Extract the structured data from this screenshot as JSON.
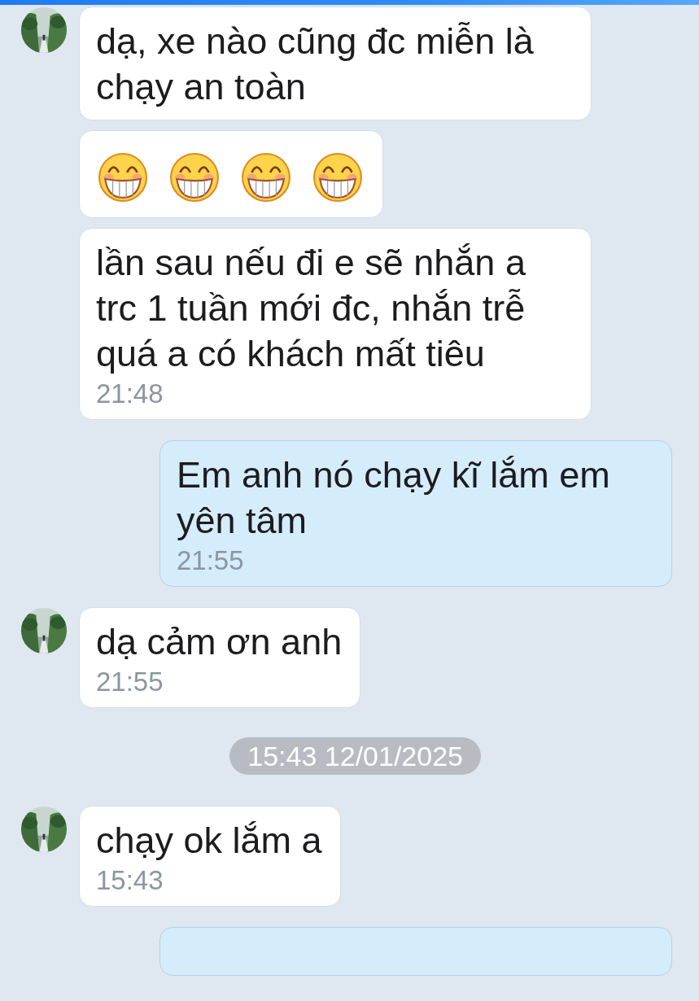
{
  "messages": [
    {
      "from_me": false,
      "avatar": true,
      "kind": "text",
      "text": "dạ, xe nào cũng đc miễn là chạy an toàn"
    },
    {
      "from_me": false,
      "avatar": false,
      "kind": "stickers",
      "stickers": [
        {
          "kind": "grin"
        },
        {
          "kind": "grin"
        },
        {
          "kind": "grin"
        },
        {
          "kind": "grin"
        }
      ]
    },
    {
      "from_me": false,
      "avatar": false,
      "kind": "text",
      "text": "lần sau nếu đi e sẽ nhắn a trc 1 tuần mới đc, nhắn trễ quá a có khách mất tiêu",
      "time": "21:48"
    },
    {
      "from_me": true,
      "kind": "text",
      "text": "Em anh nó chạy kĩ lắm em yên tâm",
      "time": "21:55"
    },
    {
      "from_me": false,
      "avatar": true,
      "kind": "text",
      "text": "dạ cảm ơn anh",
      "time": "21:55"
    },
    {
      "kind": "separator",
      "text": "15:43 12/01/2025"
    },
    {
      "from_me": false,
      "avatar": true,
      "kind": "text",
      "text": "chạy ok lắm a",
      "time": "15:43"
    },
    {
      "from_me": true,
      "kind": "cut"
    }
  ]
}
